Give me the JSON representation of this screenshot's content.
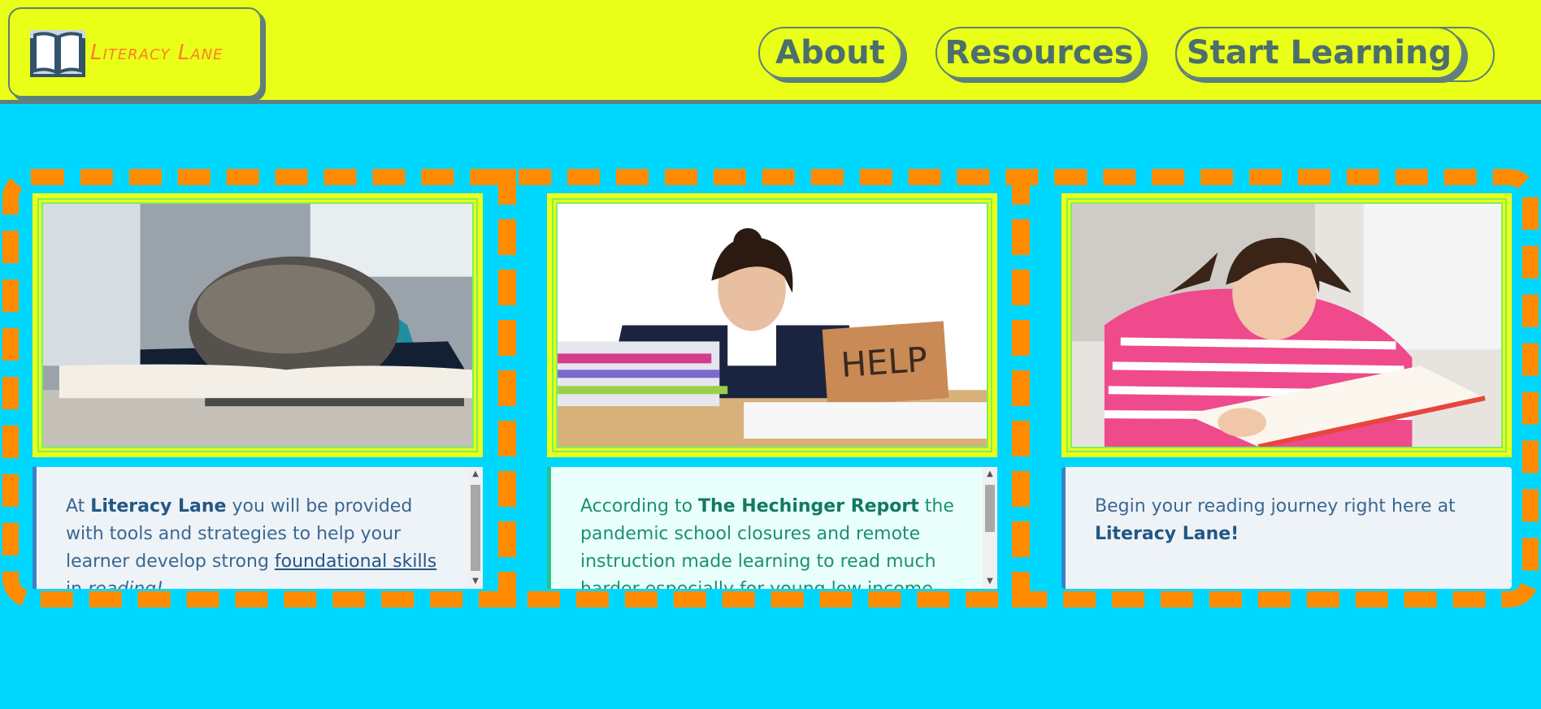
{
  "header": {
    "logo_text": "Literacy Lane",
    "nav": {
      "about": "About",
      "resources": "Resources",
      "start": "Start Learning"
    }
  },
  "cards": [
    {
      "image_alt": "Child resting head on an open book",
      "text_parts": {
        "p1": "At ",
        "b1": "Literacy Lane",
        "p2": " you will be provided with tools and strategies to help your learner develop strong ",
        "link": "foundational skills",
        "p3": " in ",
        "em": "reading!"
      }
    },
    {
      "image_alt": "Girl at desk with books holding a HELP sign",
      "sign_text": "HELP",
      "text_parts": {
        "p1": "According to ",
        "b1": "The Hechinger Report",
        "p2": " the pandemic school closures and remote instruction made learning to read much harder especially for young low income"
      }
    },
    {
      "image_alt": "Girl in striped shirt reading a book",
      "text_parts": {
        "p1": "Begin your reading journey right here at ",
        "b1": "Literacy Lane!"
      }
    }
  ],
  "colors": {
    "background": "#00d7ff",
    "header": "#eaff17",
    "frame_dash": "#ff8c00",
    "accent_text": "#4b6f6c",
    "logo_text": "#ff7e2a"
  }
}
